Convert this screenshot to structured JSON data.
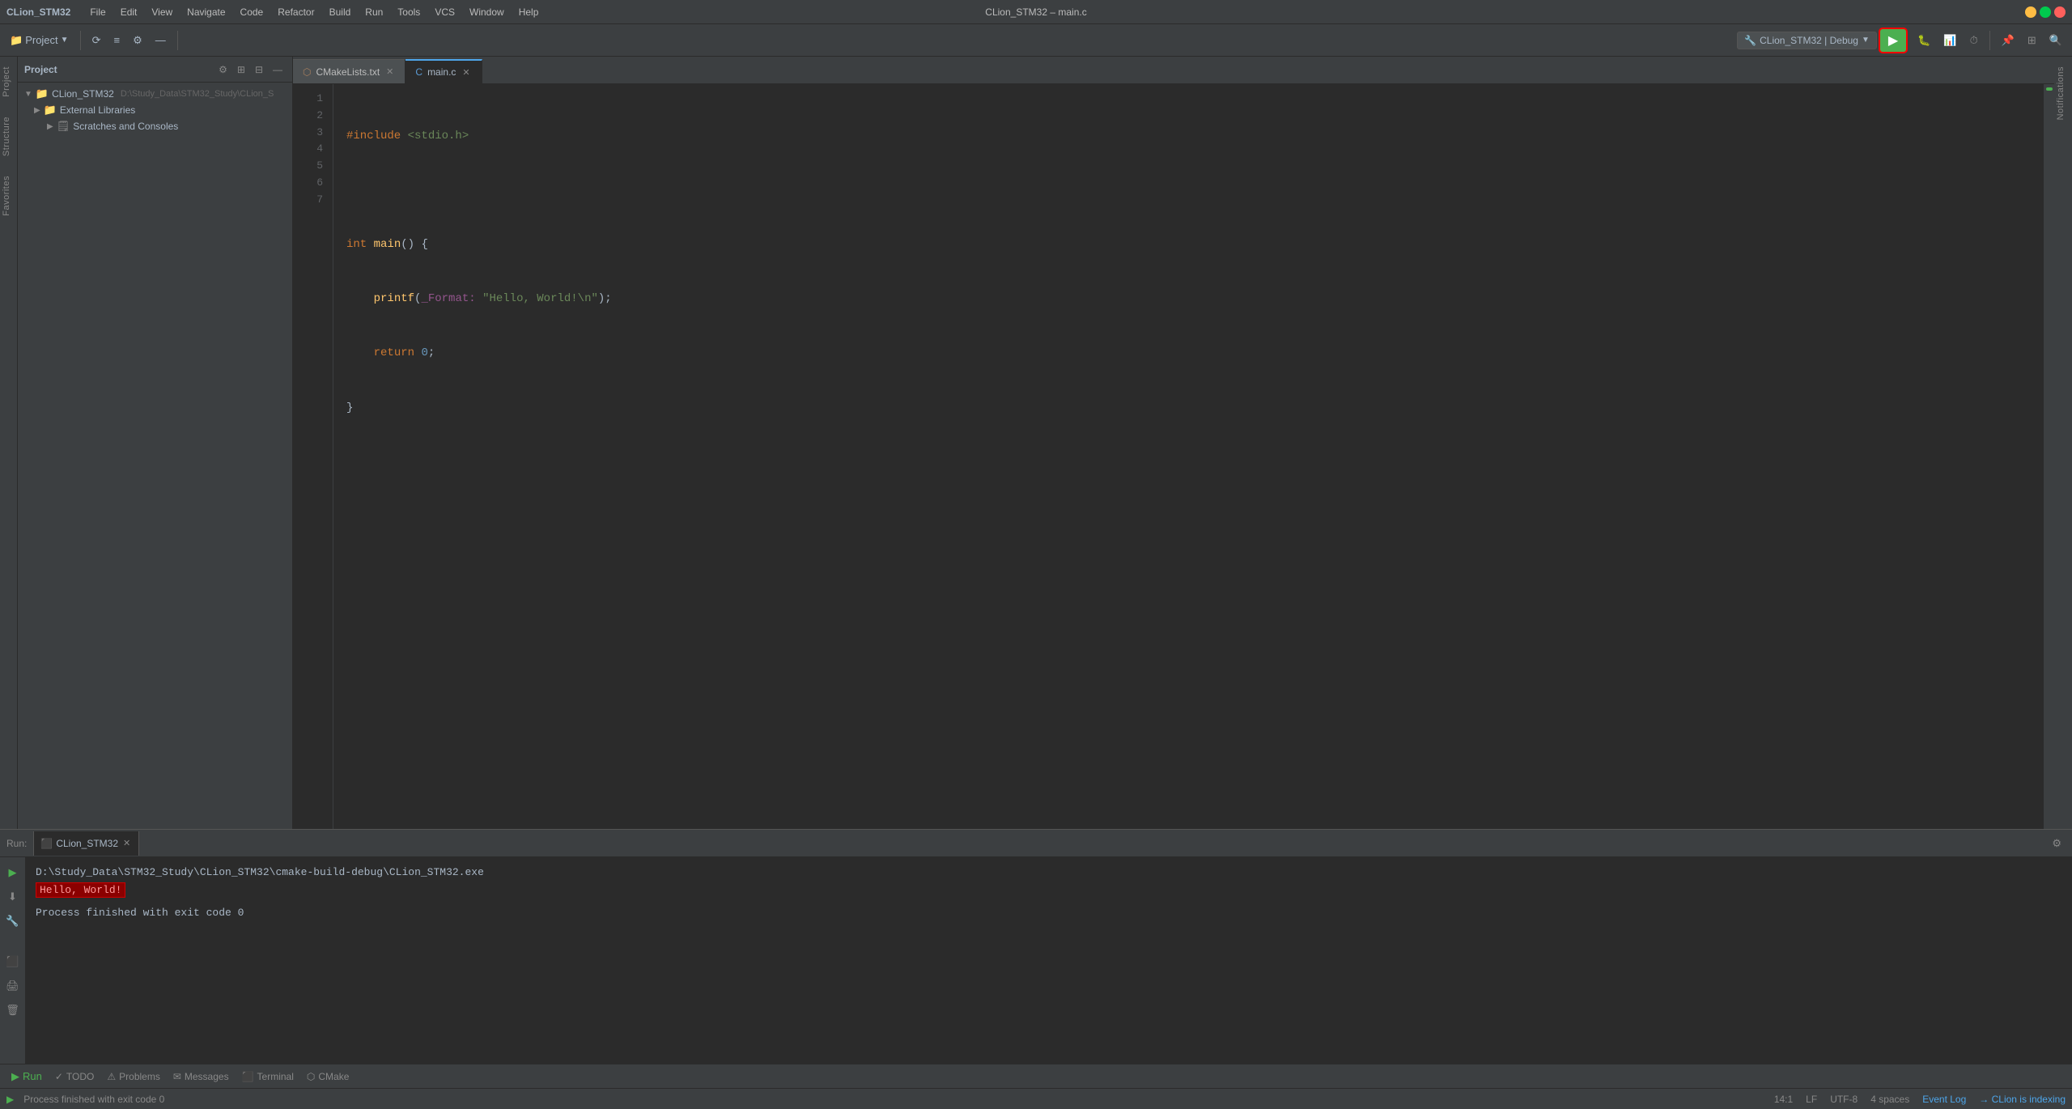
{
  "window": {
    "title": "CLion_STM32 – main.c",
    "app_name": "CLion_STM32"
  },
  "menu": {
    "items": [
      "File",
      "Edit",
      "View",
      "Navigate",
      "Code",
      "Refactor",
      "Build",
      "Run",
      "Tools",
      "VCS",
      "Window",
      "Help"
    ]
  },
  "toolbar": {
    "run_config": "CLion_STM32 | Debug",
    "run_btn_label": "▶",
    "project_label": "Project"
  },
  "tabs": [
    {
      "label": "CMakeLists.txt",
      "active": false,
      "icon": "cmake"
    },
    {
      "label": "main.c",
      "active": true,
      "icon": "c-file"
    }
  ],
  "project_tree": {
    "root": "CLion_STM32",
    "root_path": "D:\\Study_Data\\STM32_Study\\CLion_S",
    "items": [
      {
        "level": 1,
        "name": "CLion_STM32",
        "type": "folder",
        "expanded": true,
        "path": "D:\\Study_Data\\STM32_Study\\CLion_S"
      },
      {
        "level": 2,
        "name": "External Libraries",
        "type": "folder",
        "expanded": false
      },
      {
        "level": 3,
        "name": "Scratches and Consoles",
        "type": "scratch",
        "expanded": false
      }
    ]
  },
  "editor": {
    "lines": [
      {
        "num": 1,
        "code": "#include <stdio.h>",
        "type": "include"
      },
      {
        "num": 2,
        "code": "",
        "type": "empty"
      },
      {
        "num": 3,
        "code": "int main() {",
        "type": "code"
      },
      {
        "num": 4,
        "code": "    printf(_Format: \"Hello, World!\\n\");",
        "type": "code"
      },
      {
        "num": 5,
        "code": "    return 0;",
        "type": "code"
      },
      {
        "num": 6,
        "code": "}",
        "type": "code"
      },
      {
        "num": 7,
        "code": "",
        "type": "empty"
      }
    ],
    "cursor_line": 14,
    "cursor_col": 1,
    "encoding": "UTF-8",
    "indent": "4 spaces",
    "line_ending": "LF"
  },
  "run_panel": {
    "label": "Run:",
    "tab_name": "CLion_STM32",
    "exe_path": "D:\\Study_Data\\STM32_Study\\CLion_STM32\\cmake-build-debug\\CLion_STM32.exe",
    "output_highlight": "Hello, World!",
    "output_finish": "Process finished with exit code 0"
  },
  "bottom_tabs": [
    {
      "label": "Run",
      "icon": "▶"
    },
    {
      "label": "TODO",
      "icon": "✓"
    },
    {
      "label": "Problems",
      "icon": "⚠"
    },
    {
      "label": "Messages",
      "icon": "✉"
    },
    {
      "label": "Terminal",
      "icon": "⬛"
    },
    {
      "label": "CMake",
      "icon": "⬡"
    }
  ],
  "status_bar": {
    "left_text": "Process finished with exit code 0",
    "cursor_pos": "14:1",
    "line_ending": "LF",
    "encoding": "UTF-8",
    "indent": "4 spaces",
    "event_log": "Event Log",
    "clion_label": "→ CLion is indexing"
  }
}
